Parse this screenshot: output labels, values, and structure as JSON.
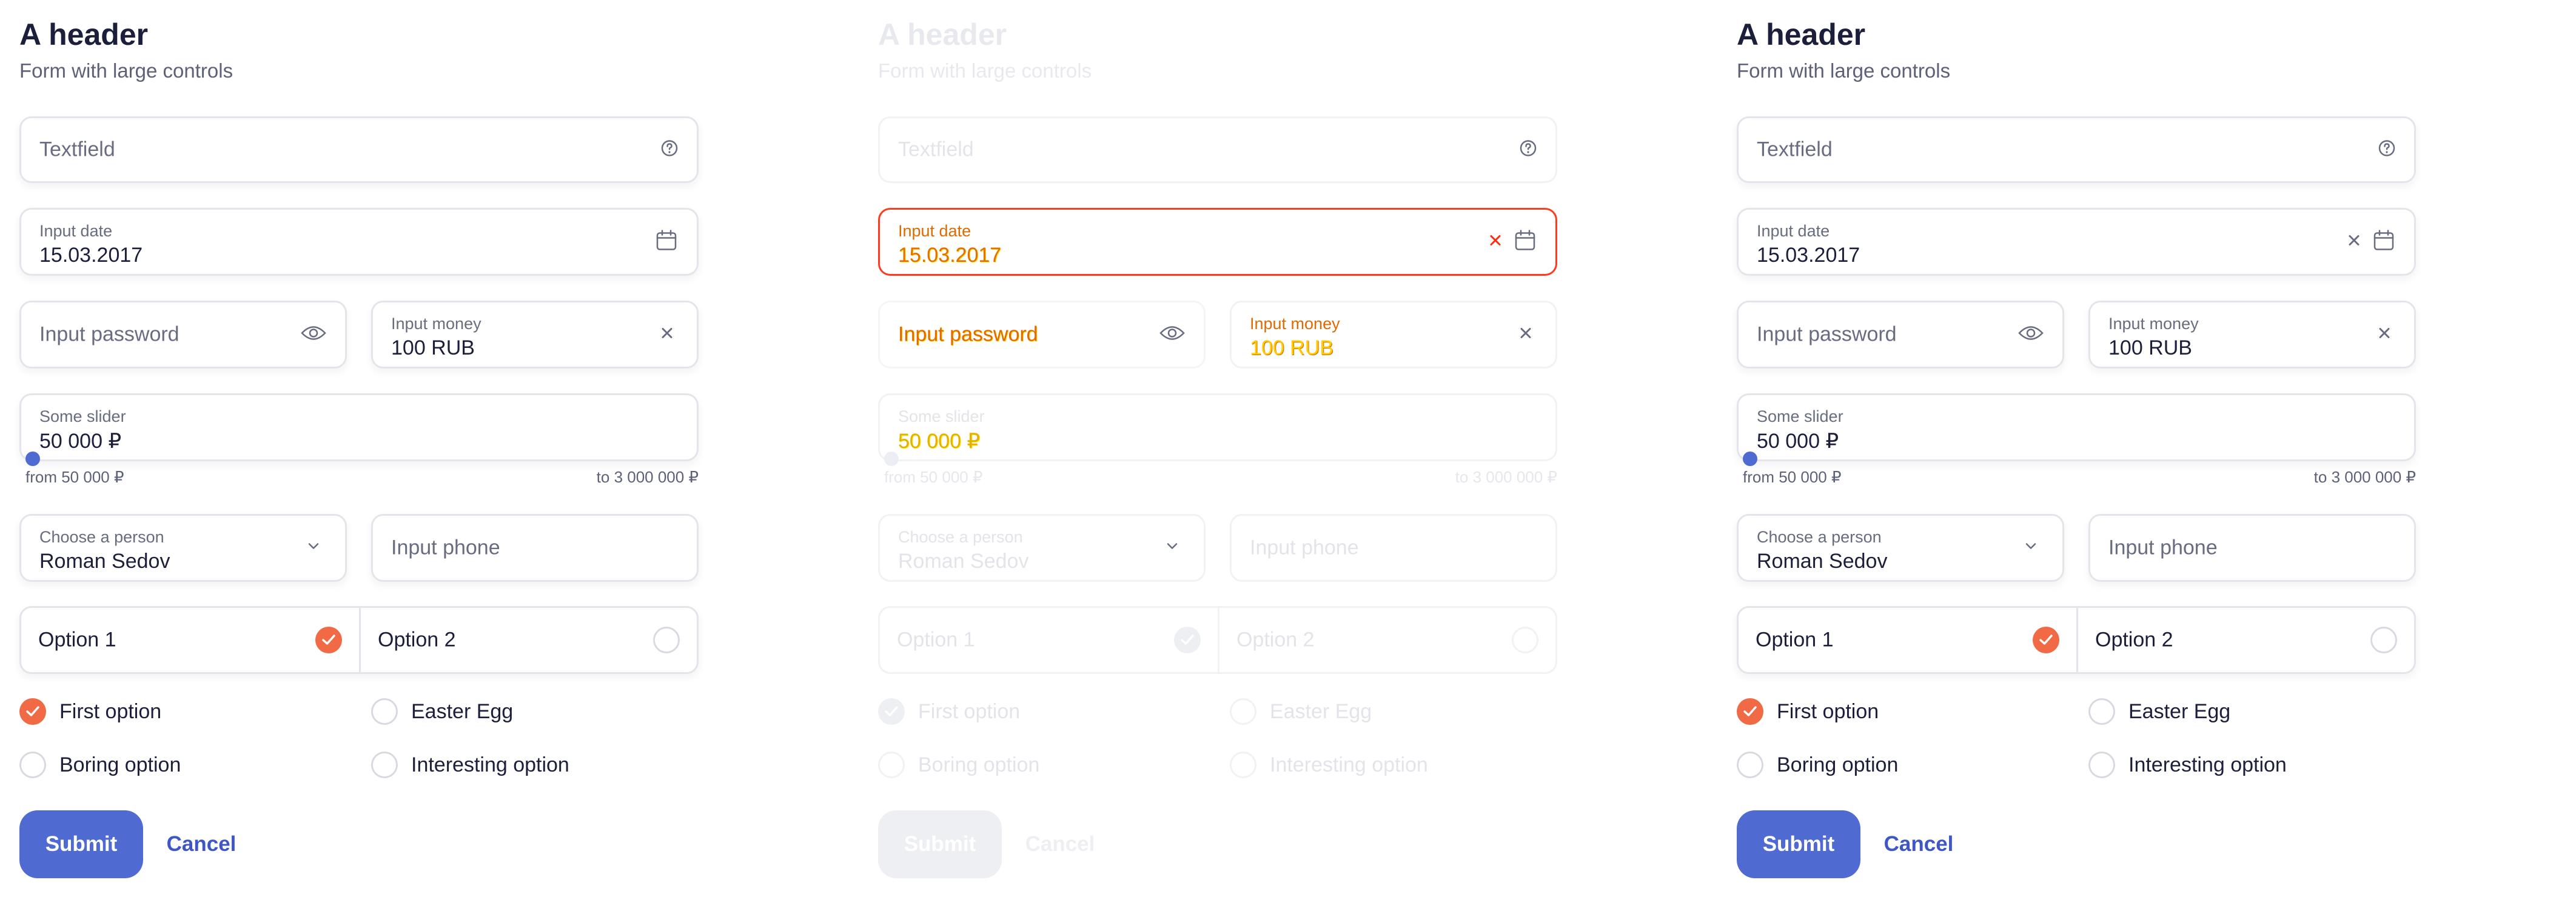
{
  "colors": {
    "accent": "#4f6ad1",
    "checked": "#f06b45",
    "text": "#1b1f3b",
    "muted": "#686c80",
    "error": "#ff3b1f"
  },
  "panels": [
    {
      "state": "default",
      "header": {
        "title": "A header",
        "subtitle": "Form with large controls"
      },
      "textfield": {
        "placeholder": "Textfield",
        "icon": "help-circle-icon"
      },
      "date": {
        "label": "Input date",
        "value": "15.03.2017",
        "icon": "calendar-icon"
      },
      "password": {
        "placeholder": "Input password",
        "icon": "eye-icon"
      },
      "money": {
        "label": "Input money",
        "value": "100 RUB",
        "icon": "close-icon"
      },
      "slider": {
        "label": "Some slider",
        "value": "50 000 ₽",
        "min_label": "from 50 000 ₽",
        "max_label": "to 3 000 000 ₽",
        "fraction": 0.0
      },
      "person": {
        "label": "Choose a person",
        "value": "Roman Sedov",
        "icon": "chevron-down-icon"
      },
      "phone": {
        "placeholder": "Input phone"
      },
      "segment": {
        "option1": "Option 1",
        "option2": "Option 2",
        "selected": 1
      },
      "radios": {
        "first": {
          "label": "First option",
          "checked": true
        },
        "easter": {
          "label": "Easter Egg",
          "checked": false
        },
        "boring": {
          "label": "Boring option",
          "checked": false
        },
        "interesting": {
          "label": "Interesting option",
          "checked": false
        }
      },
      "actions": {
        "submit": "Submit",
        "cancel": "Cancel"
      }
    },
    {
      "state": "disabled",
      "header": {
        "title": "A header",
        "subtitle": "Form with large controls"
      },
      "textfield": {
        "placeholder": "Textfield",
        "icon": "help-circle-icon"
      },
      "date": {
        "label": "Input date",
        "value": "15.03.2017",
        "icon": "calendar-icon"
      },
      "password": {
        "placeholder": "Input password",
        "icon": "eye-icon"
      },
      "money": {
        "label": "Input money",
        "value": "100 RUB",
        "icon": "close-icon"
      },
      "slider": {
        "label": "Some slider",
        "value": "50 000 ₽",
        "min_label": "from 50 000 ₽",
        "max_label": "to 3 000 000 ₽",
        "fraction": 0.0
      },
      "person": {
        "label": "Choose a person",
        "value": "Roman Sedov",
        "icon": "chevron-down-icon"
      },
      "phone": {
        "placeholder": "Input phone"
      },
      "segment": {
        "option1": "Option 1",
        "option2": "Option 2",
        "selected": 1
      },
      "radios": {
        "first": {
          "label": "First option",
          "checked": true
        },
        "easter": {
          "label": "Easter Egg",
          "checked": false
        },
        "boring": {
          "label": "Boring option",
          "checked": false
        },
        "interesting": {
          "label": "Interesting option",
          "checked": false
        }
      },
      "actions": {
        "submit": "Submit",
        "cancel": "Cancel"
      }
    },
    {
      "state": "filled",
      "header": {
        "title": "A header",
        "subtitle": "Form with large controls"
      },
      "textfield": {
        "placeholder": "Textfield",
        "icon": "help-circle-icon"
      },
      "date": {
        "label": "Input date",
        "value": "15.03.2017",
        "icon": "calendar-icon"
      },
      "password": {
        "placeholder": "Input password",
        "icon": "eye-icon"
      },
      "money": {
        "label": "Input money",
        "value": "100 RUB",
        "icon": "close-icon"
      },
      "slider": {
        "label": "Some slider",
        "value": "50 000 ₽",
        "min_label": "from 50 000 ₽",
        "max_label": "to 3 000 000 ₽",
        "fraction": 0.0
      },
      "person": {
        "label": "Choose a person",
        "value": "Roman Sedov",
        "icon": "chevron-down-icon"
      },
      "phone": {
        "placeholder": "Input phone"
      },
      "segment": {
        "option1": "Option 1",
        "option2": "Option 2",
        "selected": 1
      },
      "radios": {
        "first": {
          "label": "First option",
          "checked": true
        },
        "easter": {
          "label": "Easter Egg",
          "checked": false
        },
        "boring": {
          "label": "Boring option",
          "checked": false
        },
        "interesting": {
          "label": "Interesting option",
          "checked": false
        }
      },
      "actions": {
        "submit": "Submit",
        "cancel": "Cancel"
      }
    }
  ]
}
